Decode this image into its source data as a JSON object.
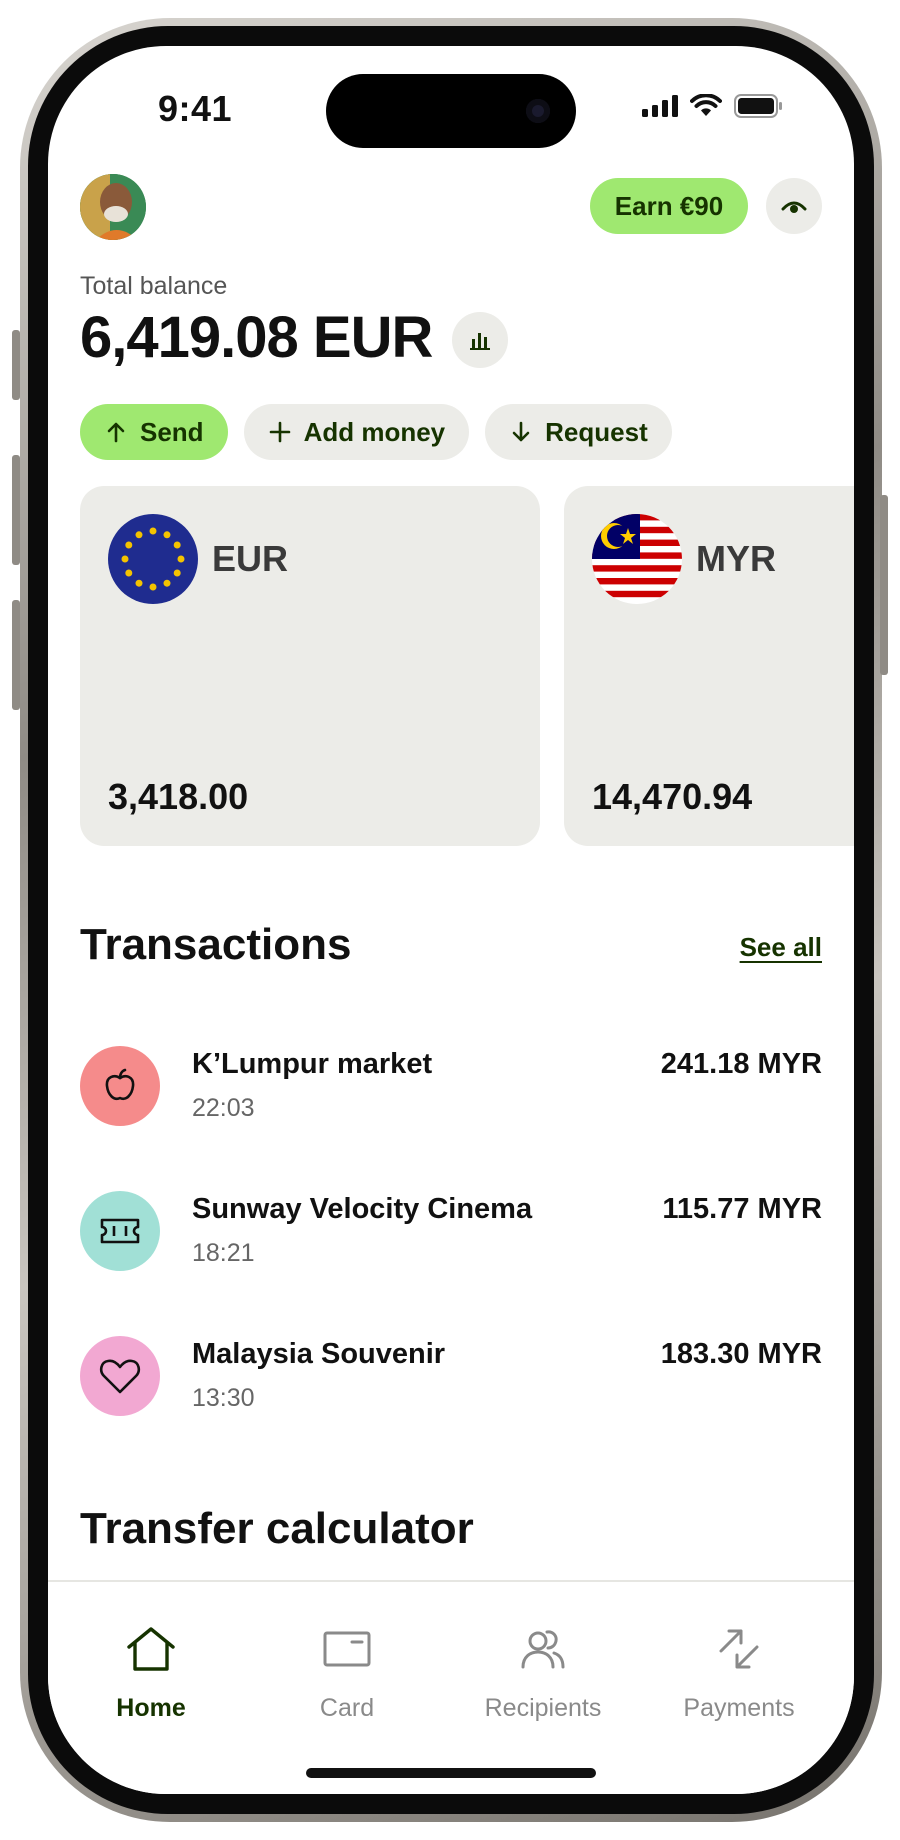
{
  "status": {
    "time": "9:41"
  },
  "header": {
    "earn_label": "Earn €90"
  },
  "balance": {
    "label": "Total balance",
    "amount": "6,419.08 EUR"
  },
  "actions": [
    {
      "label": "Send",
      "icon": "arrow-up-icon"
    },
    {
      "label": "Add money",
      "icon": "plus-icon"
    },
    {
      "label": "Request",
      "icon": "arrow-down-icon"
    }
  ],
  "currencies": [
    {
      "code": "EUR",
      "amount": "3,418.00",
      "flag": "eu-flag-icon"
    },
    {
      "code": "MYR",
      "amount": "14,470.94",
      "flag": "malaysia-flag-icon"
    }
  ],
  "transactions": {
    "title": "Transactions",
    "see_all": "See all",
    "items": [
      {
        "name": "K’Lumpur market",
        "time": "22:03",
        "amount": "241.18 MYR",
        "icon": "apple-icon",
        "color": "#f58b8b"
      },
      {
        "name": "Sunway Velocity Cinema",
        "time": "18:21",
        "amount": "115.77 MYR",
        "icon": "ticket-icon",
        "color": "#a1e0d6"
      },
      {
        "name": "Malaysia Souvenir",
        "time": "13:30",
        "amount": "183.30 MYR",
        "icon": "heart-icon",
        "color": "#f2a8d2"
      }
    ]
  },
  "calculator": {
    "title": "Transfer calculator"
  },
  "nav": [
    {
      "label": "Home",
      "icon": "home-icon",
      "active": true
    },
    {
      "label": "Card",
      "icon": "card-icon",
      "active": false
    },
    {
      "label": "Recipients",
      "icon": "recipients-icon",
      "active": false
    },
    {
      "label": "Payments",
      "icon": "payments-icon",
      "active": false
    }
  ],
  "colors": {
    "accent": "#9fe870",
    "accent_text": "#163300",
    "surface": "#ecece8"
  }
}
